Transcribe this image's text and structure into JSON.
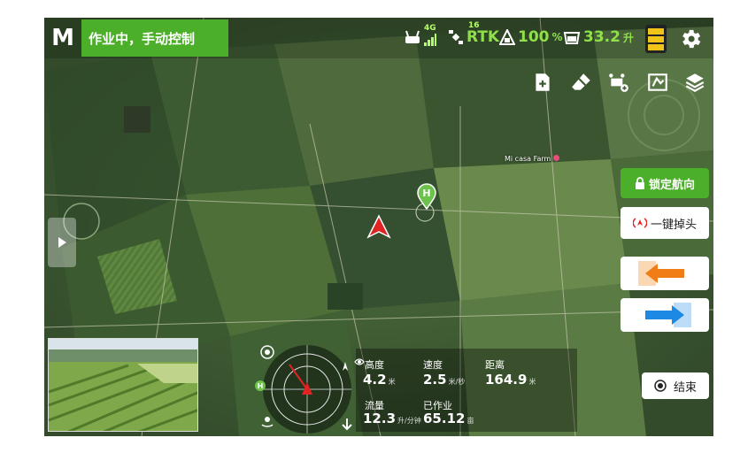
{
  "status": {
    "text": "作业中，手动控制"
  },
  "top": {
    "signal_label": "4G",
    "satellite_count": "16",
    "rtk_label": "RTK",
    "battery_pct": "100",
    "battery_unit": "%",
    "tank_value": "33.2",
    "tank_unit": "升"
  },
  "map": {
    "farm_label": "Mi casa Farm",
    "home_marker": "H"
  },
  "buttons": {
    "lock_heading": "锁定航向",
    "one_key_turn": "一键掉头",
    "end": "结束"
  },
  "telemetry": {
    "height_label": "高度",
    "height_value": "4.2",
    "height_unit": "米",
    "speed_label": "速度",
    "speed_value": "2.5",
    "speed_unit": "米/秒",
    "distance_label": "距离",
    "distance_value": "164.9",
    "distance_unit": "米",
    "flow_label": "流量",
    "flow_value": "12.3",
    "flow_unit": "升/分钟",
    "worked_label": "已作业",
    "worked_value": "65.12",
    "worked_unit": "亩"
  },
  "icons": [
    "logo-m",
    "remote-controller-icon",
    "signal-bars-icon",
    "satellite-icon",
    "tank-icon",
    "bucket-icon",
    "battery-icon",
    "gear-icon",
    "add-file-icon",
    "eraser-icon",
    "drone-plus-icon",
    "map-area-icon",
    "layers-icon",
    "expand-arrow-icon",
    "lock-icon",
    "turn-icon",
    "arrow-left-icon",
    "arrow-right-icon",
    "stop-icon",
    "eye-icon",
    "target-icon",
    "h-icon",
    "gps-icon",
    "landing-icon"
  ],
  "colors": {
    "accent": "#4caf2a",
    "arrow_orange": "#f07d16",
    "arrow_blue": "#1e88e5",
    "drone_red": "#e02424"
  }
}
